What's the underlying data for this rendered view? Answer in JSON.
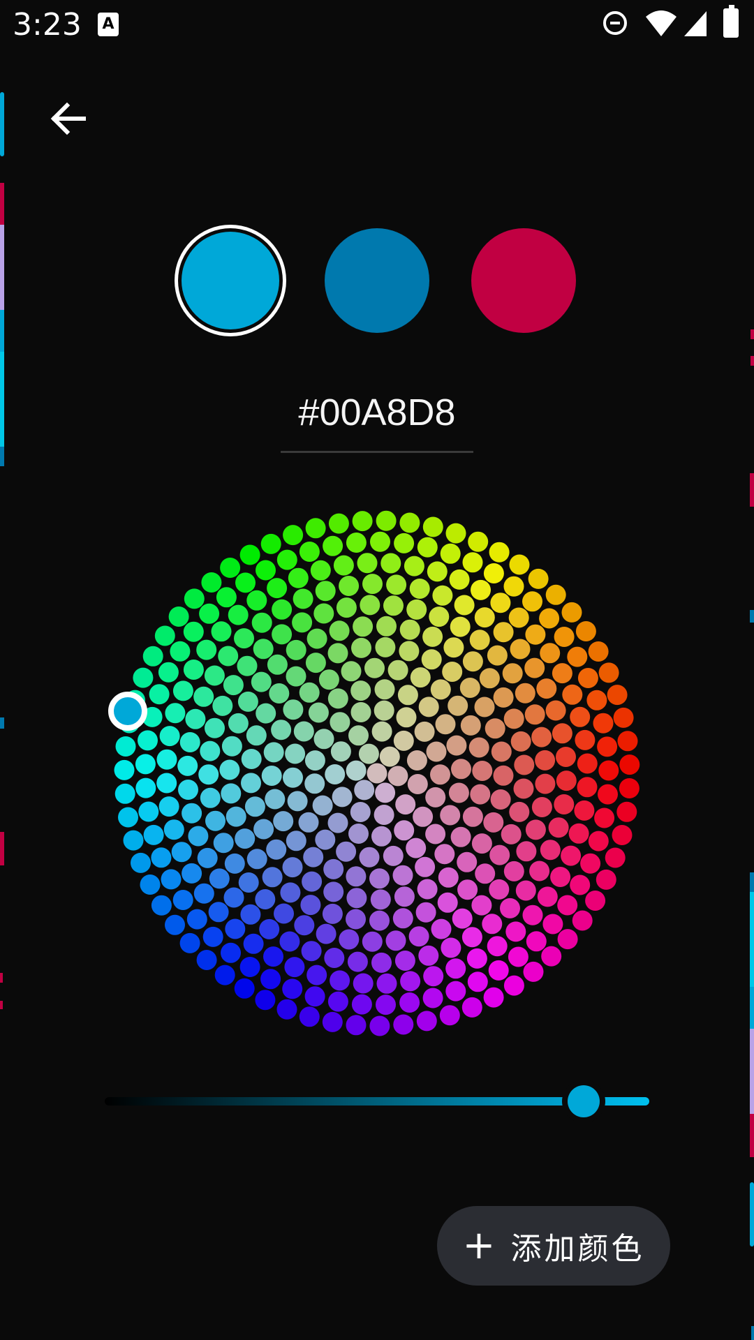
{
  "status_bar": {
    "time": "3:23",
    "icons": [
      "keyboard-a-icon",
      "do-not-disturb-icon",
      "wifi-icon",
      "cell-signal-icon",
      "battery-charging-icon"
    ]
  },
  "toolbar": {
    "back_icon": "arrow-left-icon"
  },
  "swatches": [
    {
      "color": "#00A8D8",
      "selected": true
    },
    {
      "color": "#0079AE",
      "selected": false
    },
    {
      "color": "#C10042",
      "selected": false
    }
  ],
  "hex_input": {
    "value": "#00A8D8"
  },
  "color_wheel": {
    "selected_color": "#00A8D8"
  },
  "brightness_slider": {
    "value_fraction": 0.88,
    "track_end_color": "#00A8D8"
  },
  "fab": {
    "icon": "plus-icon",
    "label": "添加颜色"
  },
  "colors": {
    "background": "#0a0a0a",
    "fab_background": "#2b2d33",
    "accent": "#00A8D8"
  }
}
